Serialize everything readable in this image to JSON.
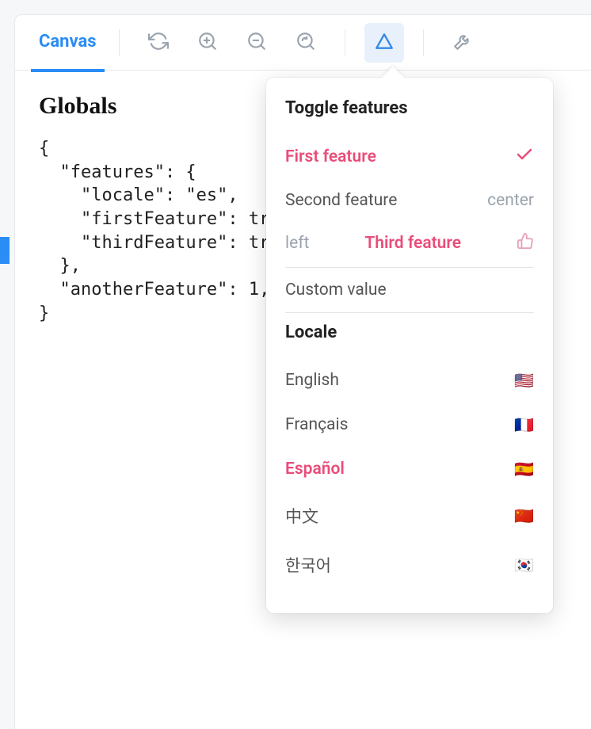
{
  "toolbar": {
    "tab_label": "Canvas"
  },
  "content": {
    "heading": "Globals",
    "code": "{\n  \"features\": {\n    \"locale\": \"es\",\n    \"firstFeature\": true,\n    \"thirdFeature\": true,\n  },\n  \"anotherFeature\": 1,\n}"
  },
  "popover": {
    "features_title": "Toggle features",
    "items": [
      {
        "label": "First feature",
        "selected": true,
        "icon": "check"
      },
      {
        "label": "Second feature",
        "selected": false,
        "right": "center"
      },
      {
        "left": "left",
        "label": "Third feature",
        "selected": true,
        "icon": "thumbs"
      },
      {
        "label": "Custom value",
        "selected": false
      }
    ],
    "locale_title": "Locale",
    "locales": [
      {
        "label": "English",
        "flag": "🇺🇸",
        "selected": false
      },
      {
        "label": "Français",
        "flag": "🇫🇷",
        "selected": false
      },
      {
        "label": "Español",
        "flag": "🇪🇸",
        "selected": true
      },
      {
        "label": "中文",
        "flag": "🇨🇳",
        "selected": false
      },
      {
        "label": "한국어",
        "flag": "🇰🇷",
        "selected": false
      }
    ]
  }
}
